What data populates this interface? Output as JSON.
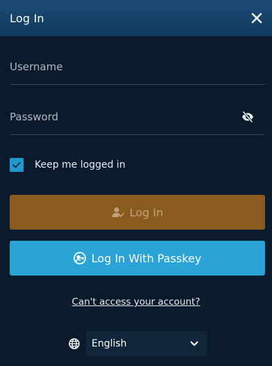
{
  "header": {
    "title": "Log In"
  },
  "form": {
    "username_placeholder": "Username",
    "password_placeholder": "Password",
    "keep_logged_in_label": "Keep me logged in",
    "keep_logged_in_checked": true,
    "login_button_label": "Log In",
    "passkey_button_label": "Log In With Passkey",
    "cant_access_link": "Can't access your account?"
  },
  "language": {
    "selected": "English"
  },
  "icons": {
    "close": "close-icon",
    "password_visibility": "eye-slash-icon",
    "checkbox": "check-icon",
    "login": "user-check-icon",
    "passkey": "passkey-icon",
    "language": "globe-icon",
    "dropdown": "chevron-down-icon"
  },
  "colors": {
    "background": "#0b1b2b",
    "header": "#1c4a74",
    "login_button": "#8a5b1e",
    "passkey_button": "#2aa4d6",
    "checkbox": "#1f9ad0"
  }
}
